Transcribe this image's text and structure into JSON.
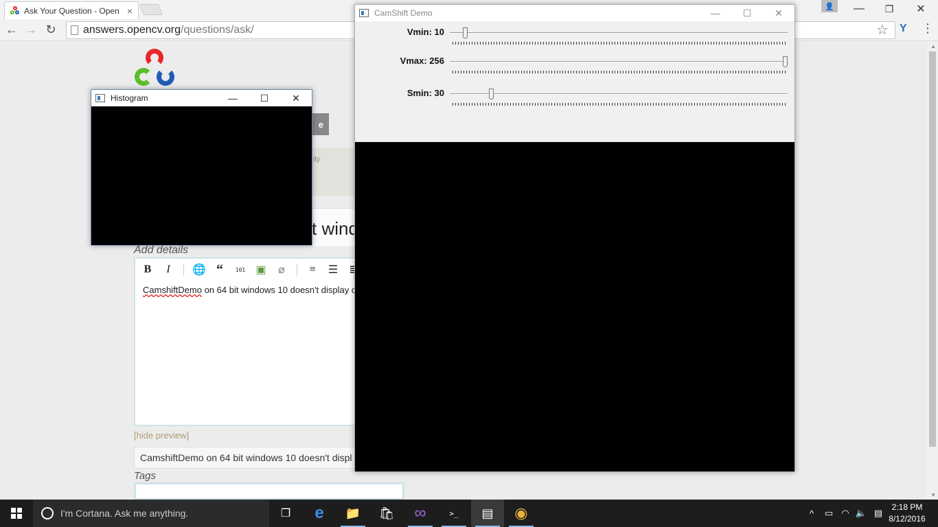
{
  "browser": {
    "tab_title": "Ask Your Question - Open",
    "tab_close": "×",
    "url_domain": "answers.opencv.org",
    "url_path": "/questions/ask/",
    "back_glyph": "←",
    "forward_glyph": "→",
    "reload_glyph": "↻",
    "star_glyph": "☆",
    "ext_glyph": "Y",
    "menu_glyph": "⋮",
    "profile_glyph": "👤",
    "minimize_glyph": "—",
    "restore_glyph": "❐",
    "close_glyph": "✕"
  },
  "page": {
    "gray_button_label": "e",
    "info_box_text": "ity",
    "title_value_fragment": "t wind",
    "add_details_label": "Add details",
    "editor_toolbar": {
      "bold": "B",
      "italic": "I",
      "link": "🌐",
      "quote": "“",
      "code": "101",
      "image": "▣",
      "attach": "⌀",
      "ordered_list": "≡",
      "bullet_list": "☰",
      "heading": "≣"
    },
    "editor_text_misspelled": "CamshiftDemo",
    "editor_text_rest": " on 64 bit windows 10 doesn't display c",
    "hide_preview_link": "[hide preview]",
    "preview_text": "CamshiftDemo on 64 bit windows 10 doesn't displ",
    "tags_label": "Tags",
    "scroll_up": "▲",
    "scroll_down": "▼"
  },
  "histogram_window": {
    "title": "Histogram",
    "minimize": "—",
    "maximize": "☐",
    "close": "✕"
  },
  "camshift_window": {
    "title": "CamShift Demo",
    "minimize": "—",
    "maximize": "☐",
    "close": "✕",
    "trackbars": [
      {
        "label": "Vmin: 10",
        "value": 10,
        "max": 256
      },
      {
        "label": "Vmax: 256",
        "value": 256,
        "max": 256
      },
      {
        "label": "Smin: 30",
        "value": 30,
        "max": 256
      }
    ]
  },
  "taskbar": {
    "cortana_placeholder": "I'm Cortana. Ask me anything.",
    "task_view_glyph": "❐",
    "edge_glyph": "e",
    "explorer_glyph": "📁",
    "store_glyph": "🛍",
    "vs_glyph": "∞",
    "cmd_glyph": ">_",
    "opencv_glyph": "▤",
    "chrome_glyph": "◉",
    "tray_chevron": "^",
    "battery_glyph": "▭",
    "wifi_glyph": "◠",
    "volume_glyph": "🔈",
    "notification_glyph": "▤",
    "time": "2:18 PM",
    "date": "8/12/2016"
  },
  "colors": {
    "opencv_red": "#e8262b",
    "opencv_green": "#5bbf2b",
    "opencv_blue": "#1f5bb8",
    "taskbar_bg": "#1d1d1d"
  }
}
